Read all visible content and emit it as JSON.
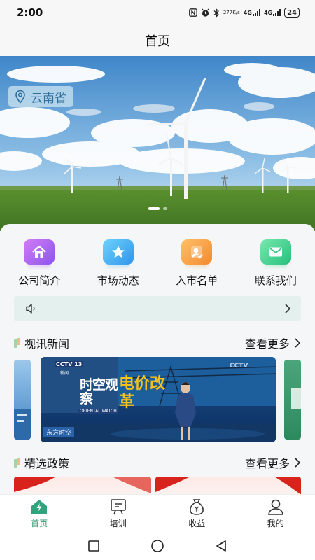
{
  "status_bar": {
    "time": "2:00",
    "net_speed_top": "277",
    "net_speed_bottom": "K/s",
    "sim1": "4G",
    "sim2": "4G",
    "battery": "24"
  },
  "header": {
    "title": "首页"
  },
  "banner": {
    "location": "云南省",
    "slide_count": 2,
    "active_slide": 1
  },
  "quick_nav": [
    {
      "label": "公司简介",
      "icon": "home-icon",
      "color": "#b06cf0"
    },
    {
      "label": "市场动态",
      "icon": "star-icon",
      "color": "#3ab3ef"
    },
    {
      "label": "入市名单",
      "icon": "user-check-icon",
      "color": "#f5a545"
    },
    {
      "label": "联系我们",
      "icon": "mail-icon",
      "color": "#3fd38c"
    }
  ],
  "notice": {
    "icon": "speaker-icon",
    "text": ""
  },
  "news_section": {
    "title": "视讯新闻",
    "more": "查看更多",
    "cards": [
      {
        "channel": "CCTV 13",
        "channel_sub": "新闻",
        "show": "时空观察",
        "show_en": "ORIENTAL WATCH",
        "headline": "电价改革",
        "ticker": "东方时空"
      }
    ]
  },
  "policy_section": {
    "title": "精选政策",
    "more": "查看更多"
  },
  "tabs": [
    {
      "label": "首页",
      "icon": "home-bolt-icon",
      "active": true
    },
    {
      "label": "培训",
      "icon": "training-board-icon",
      "active": false
    },
    {
      "label": "收益",
      "icon": "money-bag-icon",
      "active": false
    },
    {
      "label": "我的",
      "icon": "profile-icon",
      "active": false
    }
  ],
  "colors": {
    "accent": "#2f9a72",
    "notice_bg": "#e4f0ee"
  }
}
